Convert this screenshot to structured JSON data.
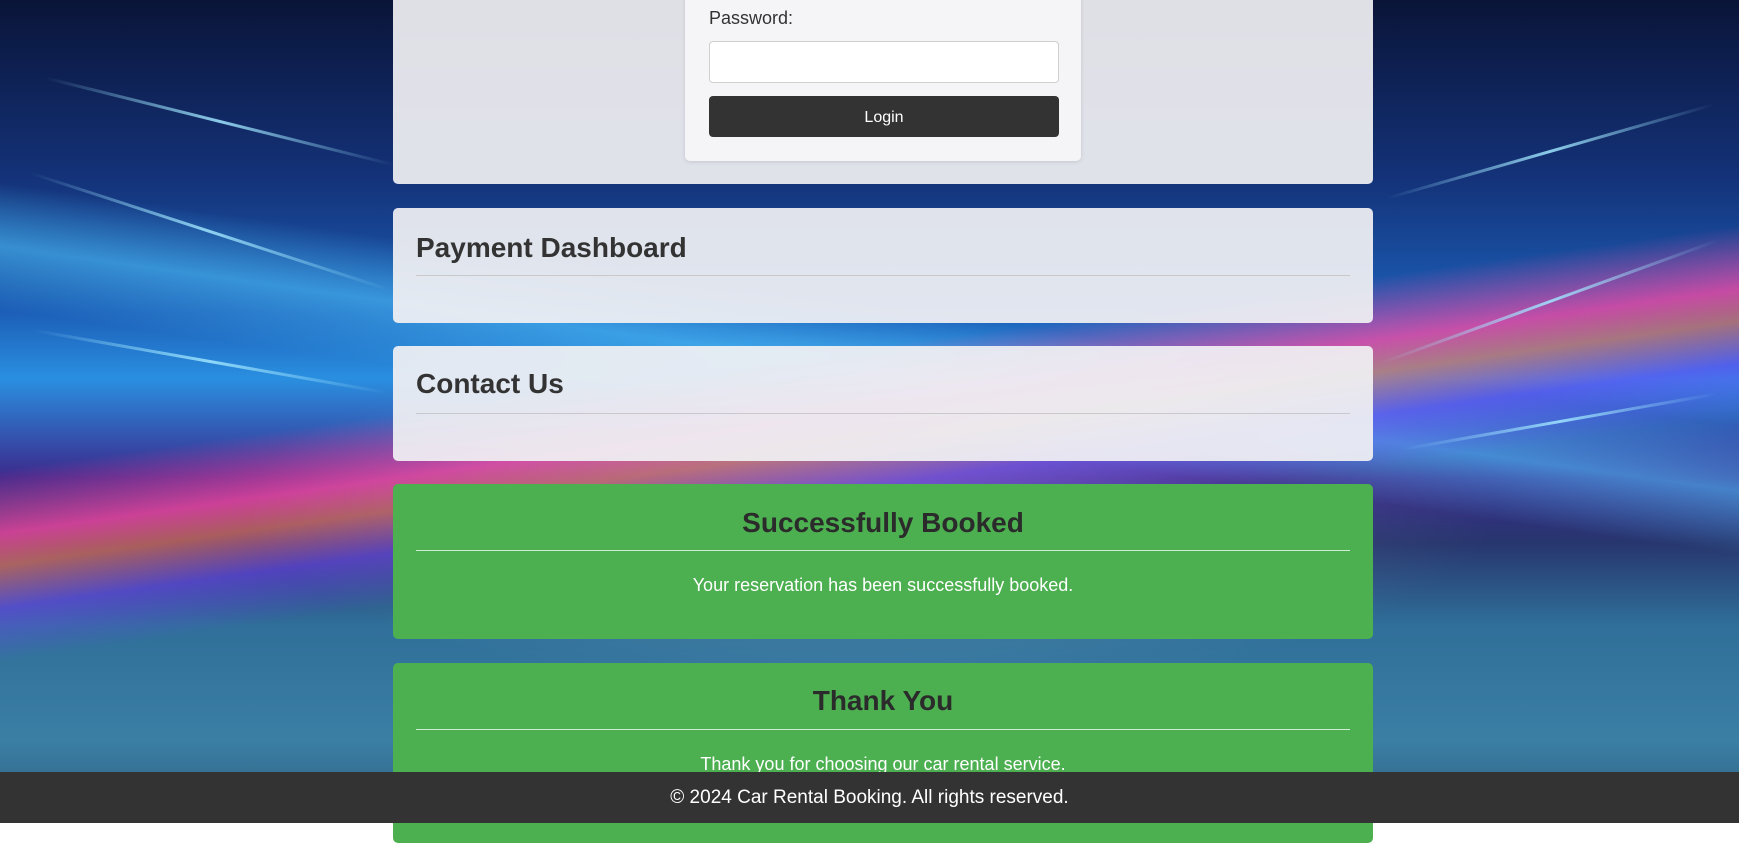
{
  "login": {
    "password_label": "Password:",
    "password_value": "",
    "login_button": "Login"
  },
  "payment": {
    "title": "Payment Dashboard"
  },
  "contact": {
    "title": "Contact Us"
  },
  "booking_success": {
    "title": "Successfully Booked",
    "message": "Your reservation has been successfully booked."
  },
  "thank_you": {
    "title": "Thank You",
    "message": "Thank you for choosing our car rental service."
  },
  "footer": {
    "text": "© 2024 Car Rental Booking. All rights reserved."
  },
  "colors": {
    "success_green": "#4caf50",
    "dark_button": "#333333",
    "footer_bg": "#333333",
    "card_bg": "#f0f0f3"
  },
  "background": {
    "description_icon": "car-light-trails-background-image"
  }
}
